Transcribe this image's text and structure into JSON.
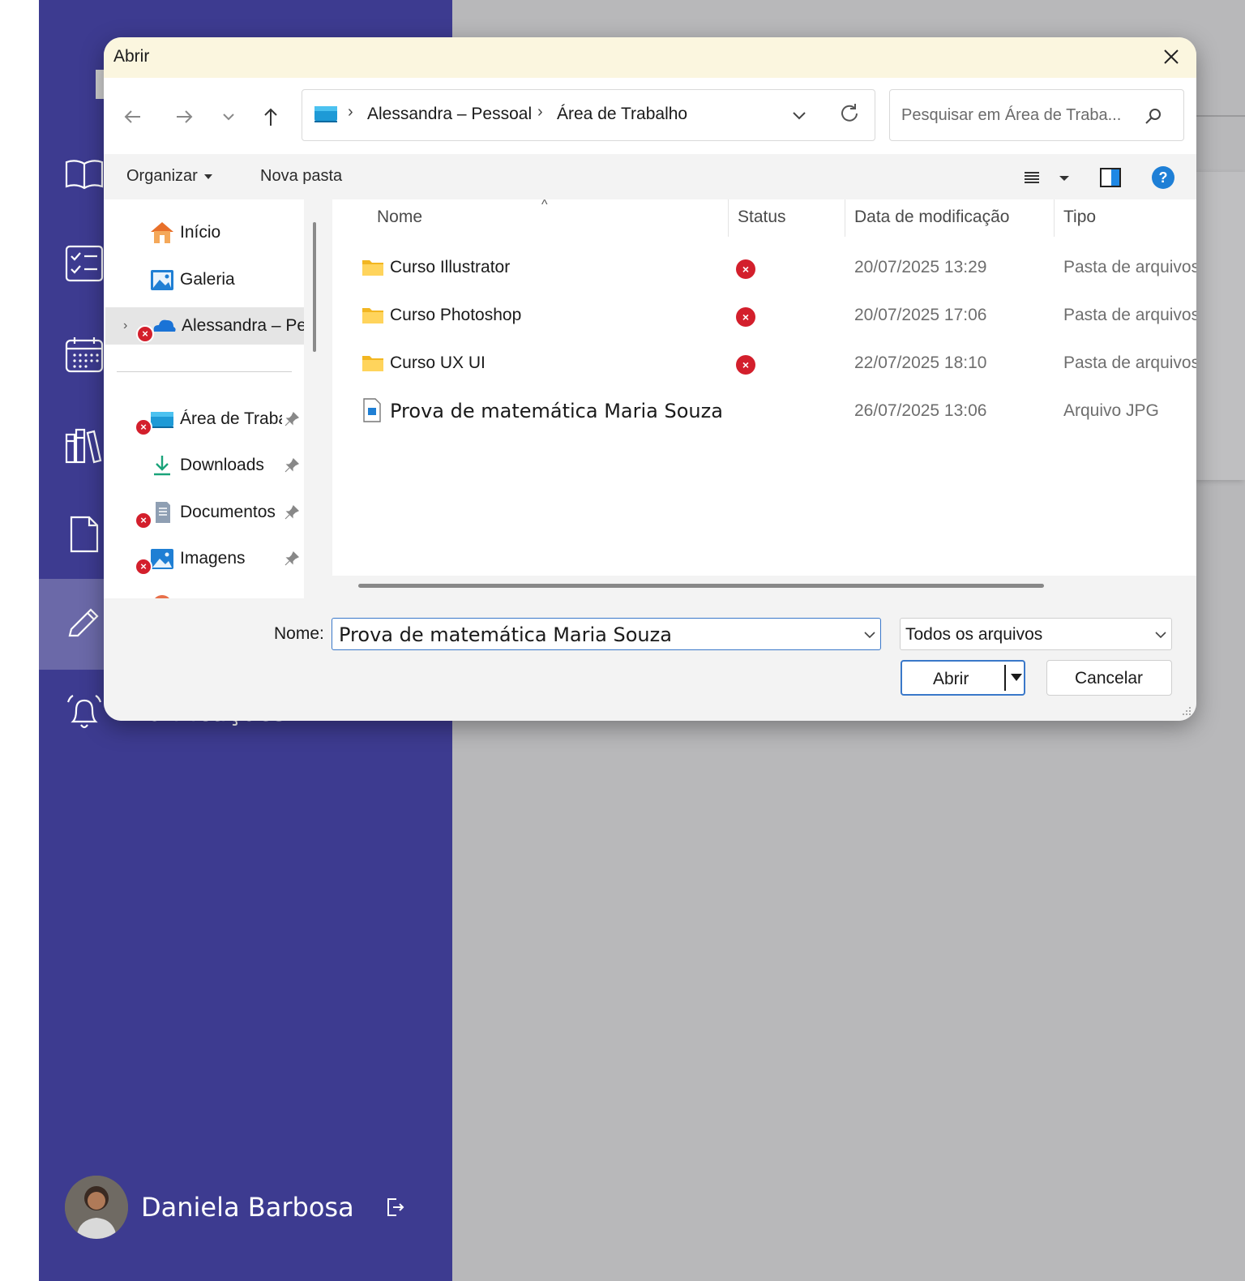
{
  "app": {
    "sidebar": {
      "partial_label": "Notificações",
      "user_name": "Daniela Barbosa"
    }
  },
  "dialog": {
    "title": "Abrir",
    "breadcrumb": [
      "Alessandra – Pessoal",
      "Área de Trabalho"
    ],
    "search_placeholder": "Pesquisar em Área de Traba...",
    "toolbar": {
      "organize": "Organizar",
      "new_folder": "Nova pasta"
    },
    "nav_pane": {
      "quick": [
        {
          "label": "Início"
        },
        {
          "label": "Galeria"
        },
        {
          "label": "Alessandra – Pessoal"
        }
      ],
      "pinned": [
        {
          "label": "Área de Trabalho"
        },
        {
          "label": "Downloads"
        },
        {
          "label": "Documentos"
        },
        {
          "label": "Imagens"
        }
      ]
    },
    "columns": {
      "name": "Nome",
      "status": "Status",
      "date": "Data de modificação",
      "type": "Tipo"
    },
    "files": [
      {
        "name": "Curso Illustrator",
        "date": "20/07/2025 13:29",
        "type": "Pasta de arquivos"
      },
      {
        "name": "Curso Photoshop",
        "date": "20/07/2025 17:06",
        "type": "Pasta de arquivos"
      },
      {
        "name": "Curso UX UI",
        "date": "22/07/2025 18:10",
        "type": "Pasta de arquivos"
      },
      {
        "name": "Prova de matemática Maria Souza",
        "date": "26/07/2025 13:06",
        "type": "Arquivo JPG"
      }
    ],
    "footer": {
      "name_label": "Nome:",
      "name_value": "Prova de matemática Maria Souza",
      "file_type": "Todos os arquivos",
      "open": "Abrir",
      "cancel": "Cancelar"
    }
  },
  "colors": {
    "sidebar": "#3d3b90",
    "accent": "#3a78c9",
    "error": "#d31f2c",
    "titlebar": "#fbf6df"
  }
}
